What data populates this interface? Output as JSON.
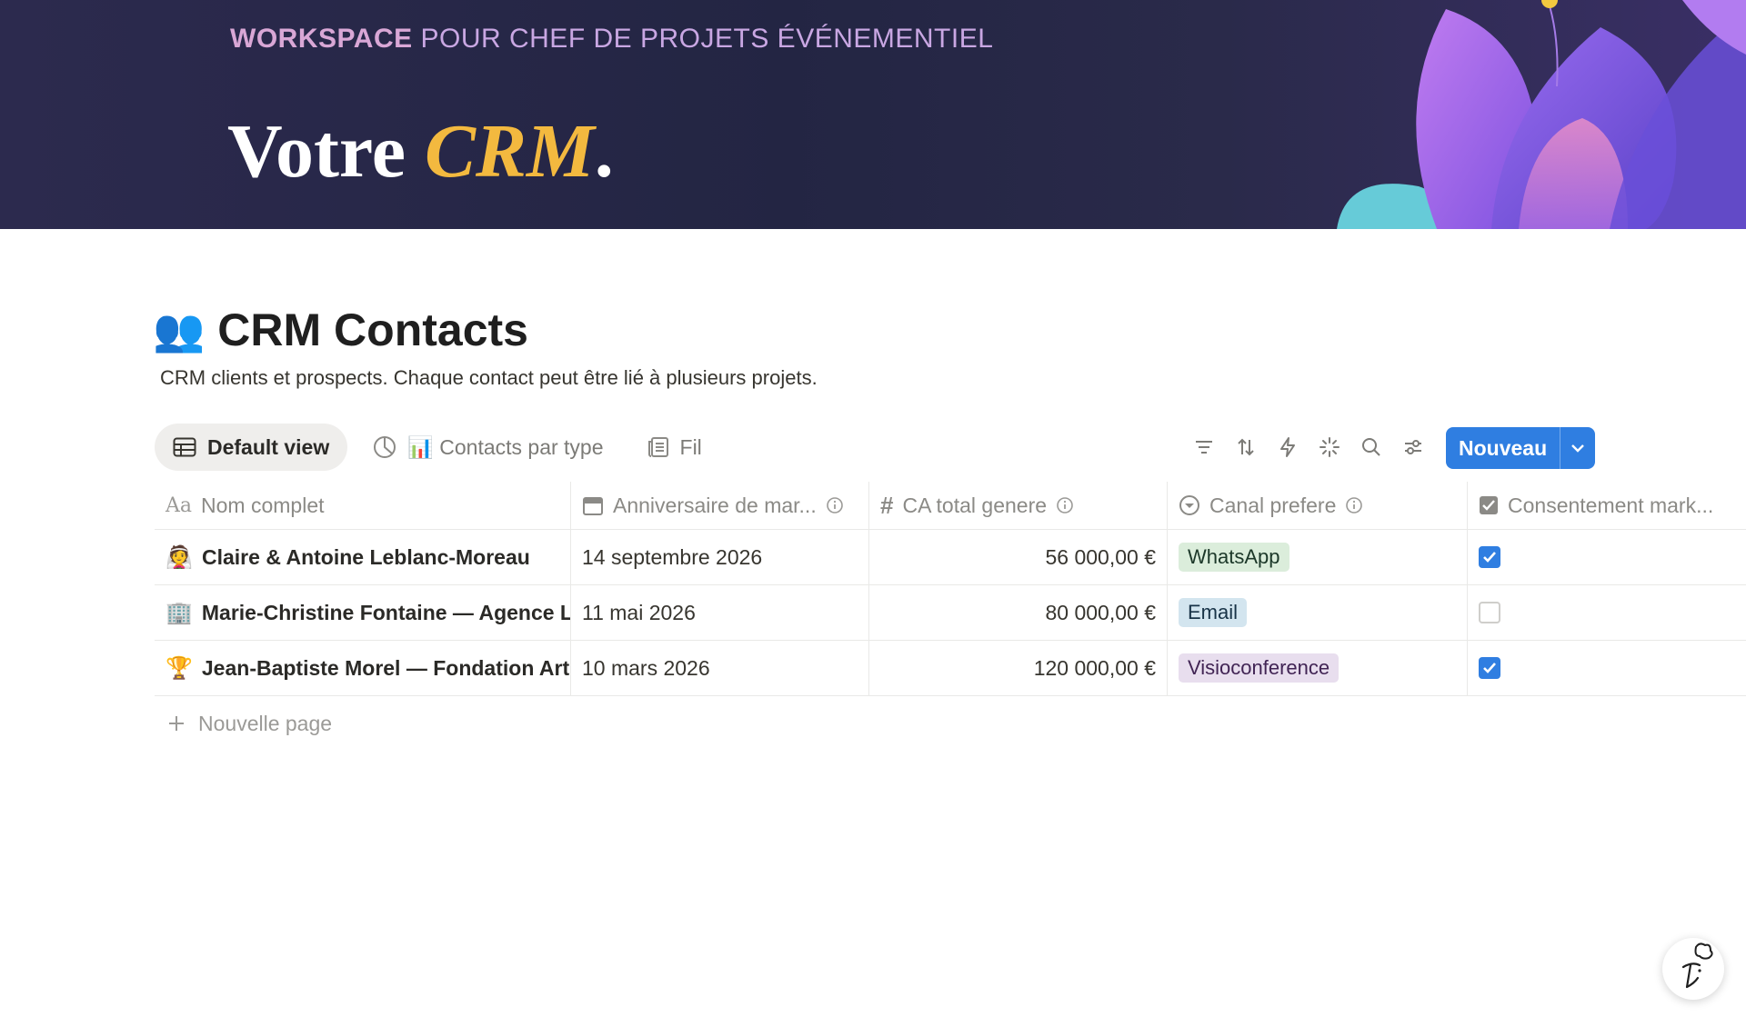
{
  "banner": {
    "eyebrow_bold": "WORKSPACE",
    "eyebrow_rest": "POUR CHEF DE PROJETS ÉVÉNEMENTIEL",
    "title_plain": "Votre ",
    "title_accent": "CRM",
    "title_dot": "."
  },
  "page": {
    "emoji": "👥",
    "title": "CRM Contacts",
    "description": "CRM clients et prospects. Chaque contact peut être lié à plusieurs projets."
  },
  "views": [
    {
      "label": "Default view",
      "icon": "table-icon"
    },
    {
      "label": "📊 Contacts par type",
      "icon": "chart-icon"
    },
    {
      "label": "Fil",
      "icon": "feed-icon"
    }
  ],
  "toolbar": {
    "new_label": "Nouveau",
    "icons": [
      "filter-icon",
      "sort-icon",
      "automation-icon",
      "ai-sparkle-icon",
      "search-icon",
      "settings-icon"
    ]
  },
  "columns": [
    {
      "label": "Nom complet",
      "icon": "text-property-icon",
      "info": false
    },
    {
      "label": "Anniversaire de mar...",
      "icon": "calendar-icon",
      "info": true
    },
    {
      "label": "CA total genere",
      "icon": "number-icon",
      "info": true
    },
    {
      "label": "Canal prefere",
      "icon": "select-icon",
      "info": true
    },
    {
      "label": "Consentement mark...",
      "icon": "checkbox-property-icon",
      "info": true
    }
  ],
  "rows": [
    {
      "emoji": "👰",
      "name": "Claire & Antoine Leblanc-Moreau",
      "date": "14 septembre 2026",
      "amount": "56 000,00 €",
      "channel": "WhatsApp",
      "channel_bg": "#dbeddb",
      "channel_fg": "#1c3829",
      "consent": true
    },
    {
      "emoji": "🏢",
      "name": "Marie-Christine Fontaine — Agence Lu",
      "date": "11 mai 2026",
      "amount": "80 000,00 €",
      "channel": "Email",
      "channel_bg": "#d3e5ef",
      "channel_fg": "#183347",
      "consent": false
    },
    {
      "emoji": "🏆",
      "name": "Jean-Baptiste Morel — Fondation Arté",
      "date": "10 mars 2026",
      "amount": "120 000,00 €",
      "channel": "Visioconference",
      "channel_bg": "#e8deee",
      "channel_fg": "#412454",
      "consent": true
    }
  ],
  "new_page_label": "Nouvelle page",
  "colors": {
    "accent": "#2f7ee1",
    "banner_accent": "#f3b93f"
  }
}
